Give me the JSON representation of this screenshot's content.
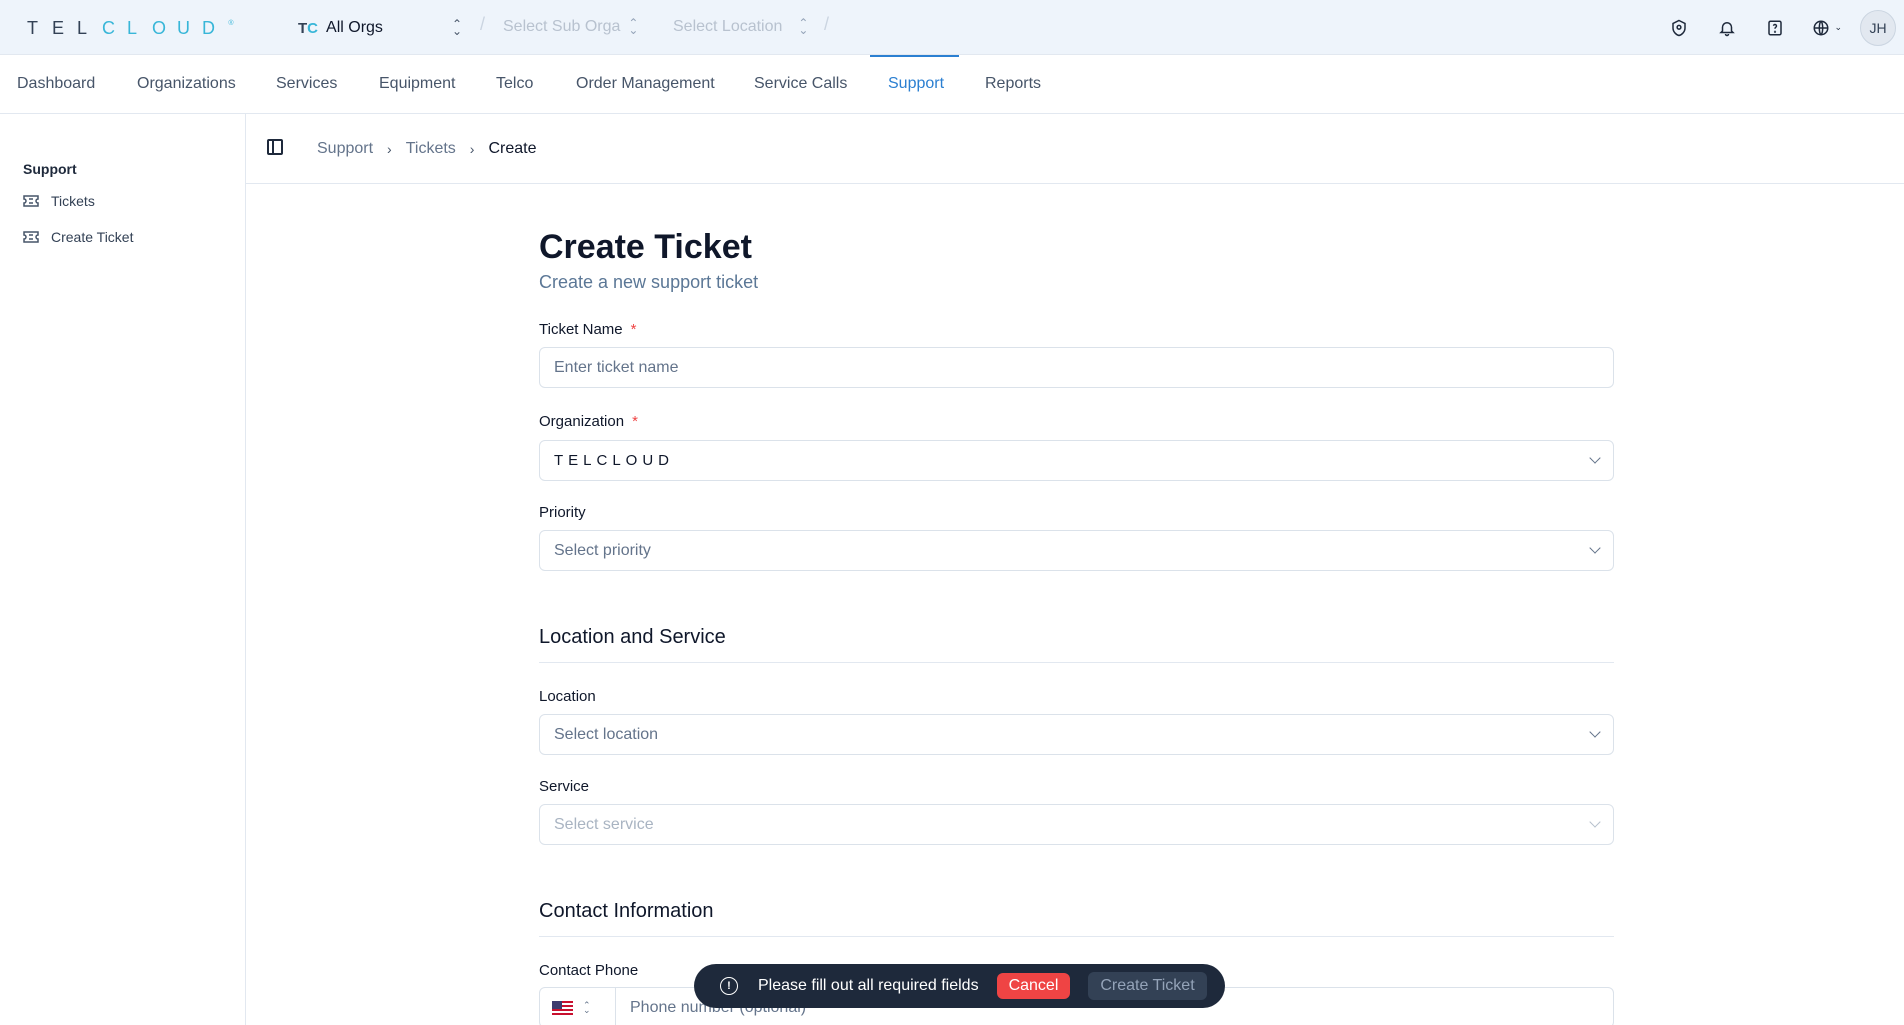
{
  "brand": {
    "logo_letters": [
      "T",
      "E",
      "L",
      "C",
      "L",
      "O",
      "U",
      "D"
    ],
    "logo_reg": "®",
    "accent": "#38b6d8"
  },
  "topbar": {
    "org_mark_t": "T",
    "org_mark_c": "C",
    "org_name": "All Orgs",
    "sub_org_placeholder": "Select Sub Orga",
    "location_placeholder": "Select Location",
    "user_initials": "JH"
  },
  "nav": {
    "items": [
      "Dashboard",
      "Organizations",
      "Services",
      "Equipment",
      "Telco",
      "Order Management",
      "Service Calls",
      "Support",
      "Reports"
    ],
    "active": "Support",
    "active_color": "#2b7fd1"
  },
  "sidebar": {
    "title": "Support",
    "items": [
      {
        "label": "Tickets",
        "icon": "ticket-icon"
      },
      {
        "label": "Create Ticket",
        "icon": "ticket-icon"
      }
    ]
  },
  "breadcrumb": [
    "Support",
    "Tickets",
    "Create"
  ],
  "form": {
    "title": "Create Ticket",
    "subtitle": "Create a new support ticket",
    "ticket_name": {
      "label": "Ticket Name",
      "required_mark": "*",
      "placeholder": "Enter ticket name",
      "value": ""
    },
    "organization": {
      "label": "Organization",
      "required_mark": "*",
      "value": "TELCLOUD"
    },
    "priority": {
      "label": "Priority",
      "placeholder": "Select priority"
    },
    "location_section": "Location and Service",
    "location": {
      "label": "Location",
      "placeholder": "Select location"
    },
    "service": {
      "label": "Service",
      "placeholder": "Select service"
    },
    "contact_section": "Contact Information",
    "contact_phone": {
      "label": "Contact Phone",
      "placeholder": "Phone number (optional)",
      "country": "US"
    }
  },
  "toast": {
    "message": "Please fill out all required fields",
    "cancel_label": "Cancel",
    "create_label": "Create Ticket",
    "cancel_color": "#ef4444"
  }
}
